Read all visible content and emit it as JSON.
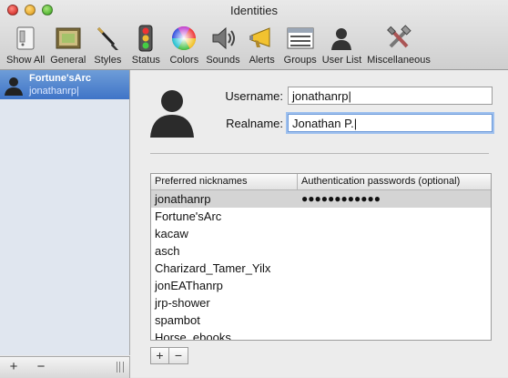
{
  "window": {
    "title": "Identities"
  },
  "toolbar": {
    "items": [
      {
        "label": "Show All",
        "icon": "show-all-icon"
      },
      {
        "label": "General",
        "icon": "general-icon"
      },
      {
        "label": "Styles",
        "icon": "paintbrush-icon"
      },
      {
        "label": "Status",
        "icon": "traffic-light-icon"
      },
      {
        "label": "Colors",
        "icon": "color-wheel-icon"
      },
      {
        "label": "Sounds",
        "icon": "speaker-icon"
      },
      {
        "label": "Alerts",
        "icon": "megaphone-icon"
      },
      {
        "label": "Groups",
        "icon": "groups-icon"
      },
      {
        "label": "User List",
        "icon": "user-list-icon"
      },
      {
        "label": "Miscellaneous",
        "icon": "tools-icon"
      }
    ]
  },
  "sidebar": {
    "identity": {
      "name": "Fortune'sArc",
      "sub": "jonathanrp|"
    },
    "add_label": "+",
    "remove_label": "−"
  },
  "main": {
    "username_label": "Username:",
    "username_value": "jonathanrp|",
    "realname_label": "Realname:",
    "realname_value": "Jonathan P.|",
    "table": {
      "col_nick": "Preferred nicknames",
      "col_pass": "Authentication passwords (optional)",
      "rows": [
        {
          "nick": "jonathanrp",
          "pass": "●●●●●●●●●●●●"
        },
        {
          "nick": "Fortune'sArc",
          "pass": ""
        },
        {
          "nick": "kacaw",
          "pass": ""
        },
        {
          "nick": "asch",
          "pass": ""
        },
        {
          "nick": "Charizard_Tamer_Yilx",
          "pass": ""
        },
        {
          "nick": "jonEAThanrp",
          "pass": ""
        },
        {
          "nick": "jrp-shower",
          "pass": ""
        },
        {
          "nick": "spambot",
          "pass": ""
        },
        {
          "nick": "Horse_ebooks",
          "pass": ""
        }
      ]
    },
    "add_label": "+",
    "remove_label": "−"
  },
  "colors": {
    "selection": "#3f74c7",
    "row_selected": "#d4d4d4",
    "focus_ring": "#9ec0ee"
  }
}
